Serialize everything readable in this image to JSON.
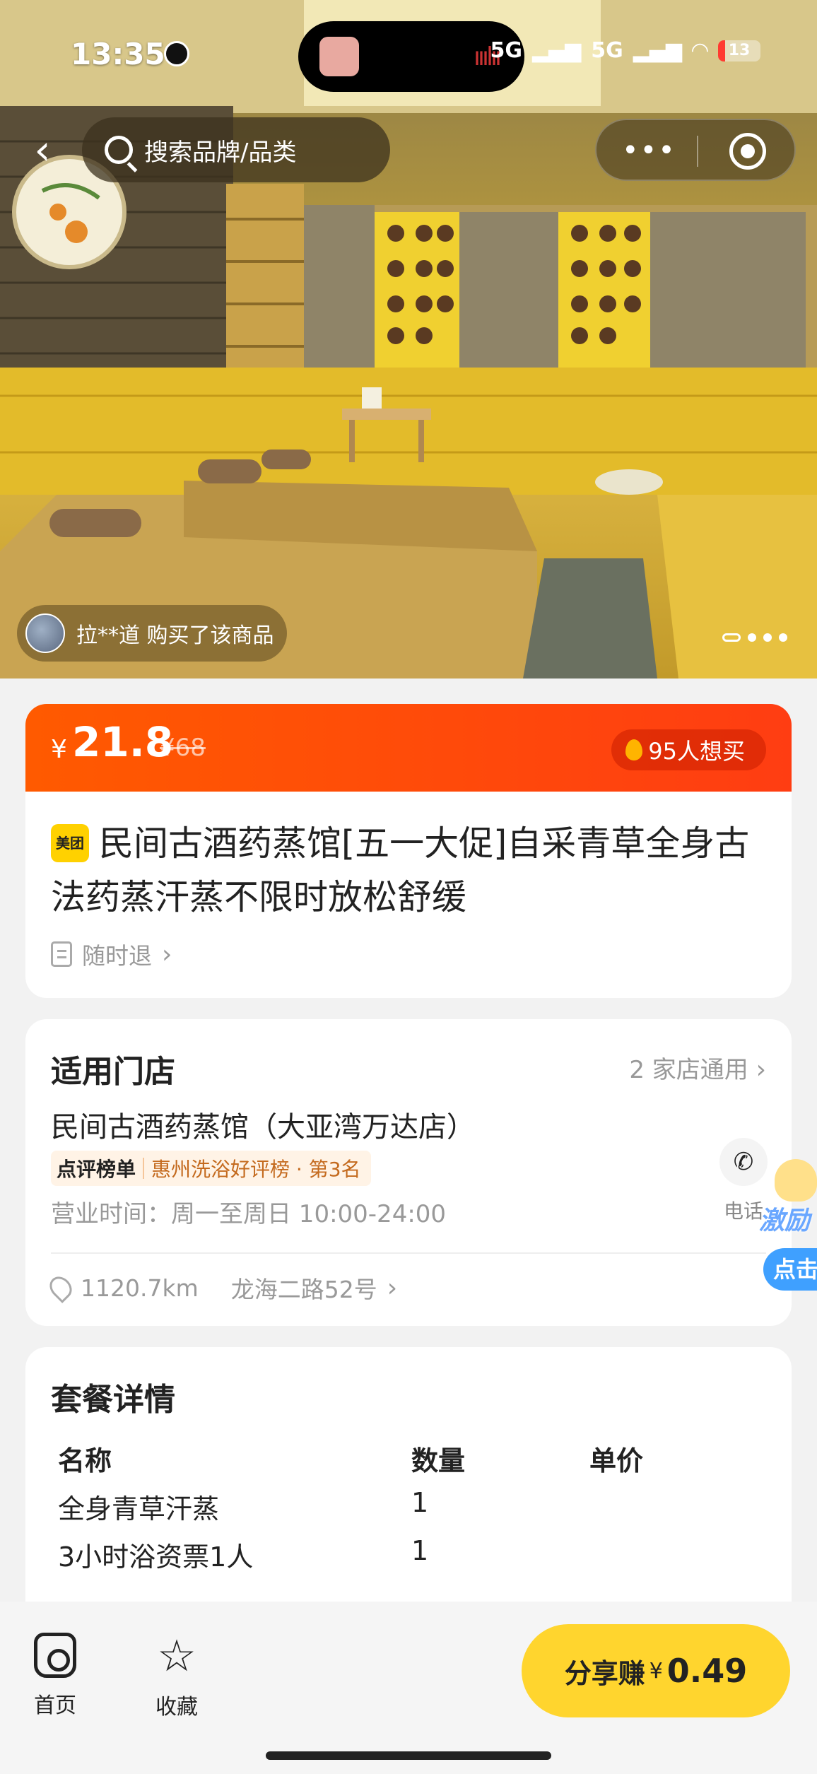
{
  "status_bar": {
    "time": "13:35",
    "network": "5G",
    "network2": "5G",
    "battery": "13"
  },
  "nav": {
    "search_placeholder": "搜索品牌/品类",
    "more_label": "•••"
  },
  "hero": {
    "buyer_notice": "拉**道 购买了该商品",
    "carousel_total": 5,
    "carousel_active": 1
  },
  "price": {
    "currency": "¥",
    "current": "21.8",
    "original": "¥68",
    "want_count": "95人想买"
  },
  "product": {
    "brand_badge": "美团",
    "title": "民间古酒药蒸馆[五一大促]自采青草全身古法药蒸汗蒸不限时放松舒缓",
    "refund": "随时退"
  },
  "store": {
    "section_title": "适用门店",
    "store_count": "2 家店通用",
    "name": "民间古酒药蒸馆（大亚湾万达店）",
    "rank_label": "点评榜单",
    "rank_text": "惠州洗浴好评榜 · 第3名",
    "hours": "营业时间：周一至周日 10:00-24:00",
    "phone_label": "电话",
    "distance": "1120.7km",
    "address": "龙海二路52号"
  },
  "reward_float": {
    "text1": "激励",
    "text2": "点击"
  },
  "package": {
    "section_title": "套餐详情",
    "columns": [
      "名称",
      "数量",
      "单价"
    ],
    "rows": [
      {
        "name": "全身青草汗蒸",
        "qty": "1",
        "price": ""
      },
      {
        "name": "3小时浴资票1人",
        "qty": "1",
        "price": ""
      }
    ]
  },
  "bottom_bar": {
    "home_label": "首页",
    "fav_label": "收藏",
    "share_label": "分享赚",
    "share_currency": "¥",
    "share_amount": "0.49"
  },
  "colors": {
    "price_bar": "#ff4b0a",
    "share_button": "#ffd52e",
    "rank_text": "#c46a1e"
  }
}
